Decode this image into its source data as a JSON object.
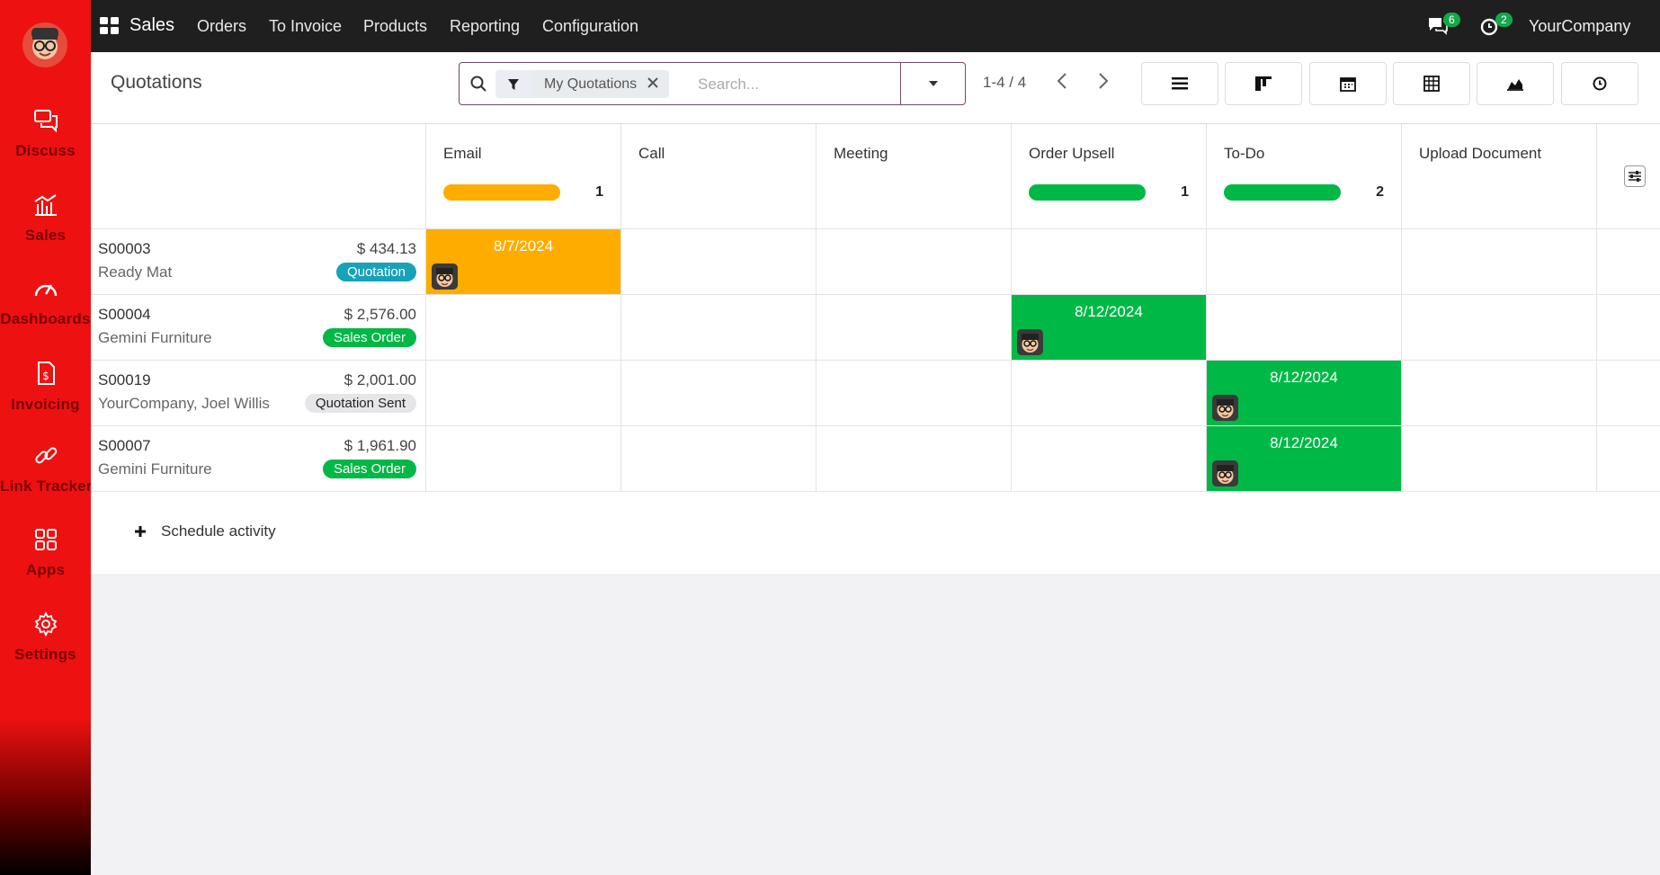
{
  "sidebar": {
    "items": [
      {
        "label": "Discuss",
        "icon": "discuss-icon"
      },
      {
        "label": "Sales",
        "icon": "sales-icon"
      },
      {
        "label": "Dashboards",
        "icon": "dashboard-icon"
      },
      {
        "label": "Invoicing",
        "icon": "invoice-icon"
      },
      {
        "label": "Link Tracker",
        "icon": "link-icon"
      },
      {
        "label": "Apps",
        "icon": "apps-icon"
      },
      {
        "label": "Settings",
        "icon": "gear-icon"
      }
    ]
  },
  "topbar": {
    "app_name": "Sales",
    "menu": [
      "Orders",
      "To Invoice",
      "Products",
      "Reporting",
      "Configuration"
    ],
    "messages_count": "6",
    "activities_count": "2",
    "company": "YourCompany"
  },
  "control": {
    "title": "Quotations",
    "facet": "My Quotations",
    "search_placeholder": "Search...",
    "pager": "1-4 / 4"
  },
  "columns": [
    {
      "name": "Email",
      "count": "1",
      "bar_color": "#ffac00"
    },
    {
      "name": "Call",
      "count": "",
      "bar_color": ""
    },
    {
      "name": "Meeting",
      "count": "",
      "bar_color": ""
    },
    {
      "name": "Order Upsell",
      "count": "1",
      "bar_color": "#00b846"
    },
    {
      "name": "To-Do",
      "count": "2",
      "bar_color": "#00b846"
    },
    {
      "name": "Upload Document",
      "count": "",
      "bar_color": ""
    }
  ],
  "rows": [
    {
      "name": "S00003",
      "customer": "Ready Mat",
      "amount": "$ 434.13",
      "status": "Quotation",
      "status_color": "#17a2b8",
      "status_text_color": "#ffffff",
      "activity_col": 0,
      "activity_date": "8/7/2024",
      "activity_color": "#ffac00"
    },
    {
      "name": "S00004",
      "customer": "Gemini Furniture",
      "amount": "$ 2,576.00",
      "status": "Sales Order",
      "status_color": "#00b846",
      "status_text_color": "#ffffff",
      "activity_col": 3,
      "activity_date": "8/12/2024",
      "activity_color": "#00b846"
    },
    {
      "name": "S00019",
      "customer": "YourCompany, Joel Willis",
      "amount": "$ 2,001.00",
      "status": "Quotation Sent",
      "status_color": "#e6e6e9",
      "status_text_color": "#222222",
      "activity_col": 4,
      "activity_date": "8/12/2024",
      "activity_color": "#00b846"
    },
    {
      "name": "S00007",
      "customer": "Gemini Furniture",
      "amount": "$ 1,961.90",
      "status": "Sales Order",
      "status_color": "#00b846",
      "status_text_color": "#ffffff",
      "activity_col": 4,
      "activity_date": "8/12/2024",
      "activity_color": "#00b846"
    }
  ],
  "schedule_activity": "Schedule activity"
}
